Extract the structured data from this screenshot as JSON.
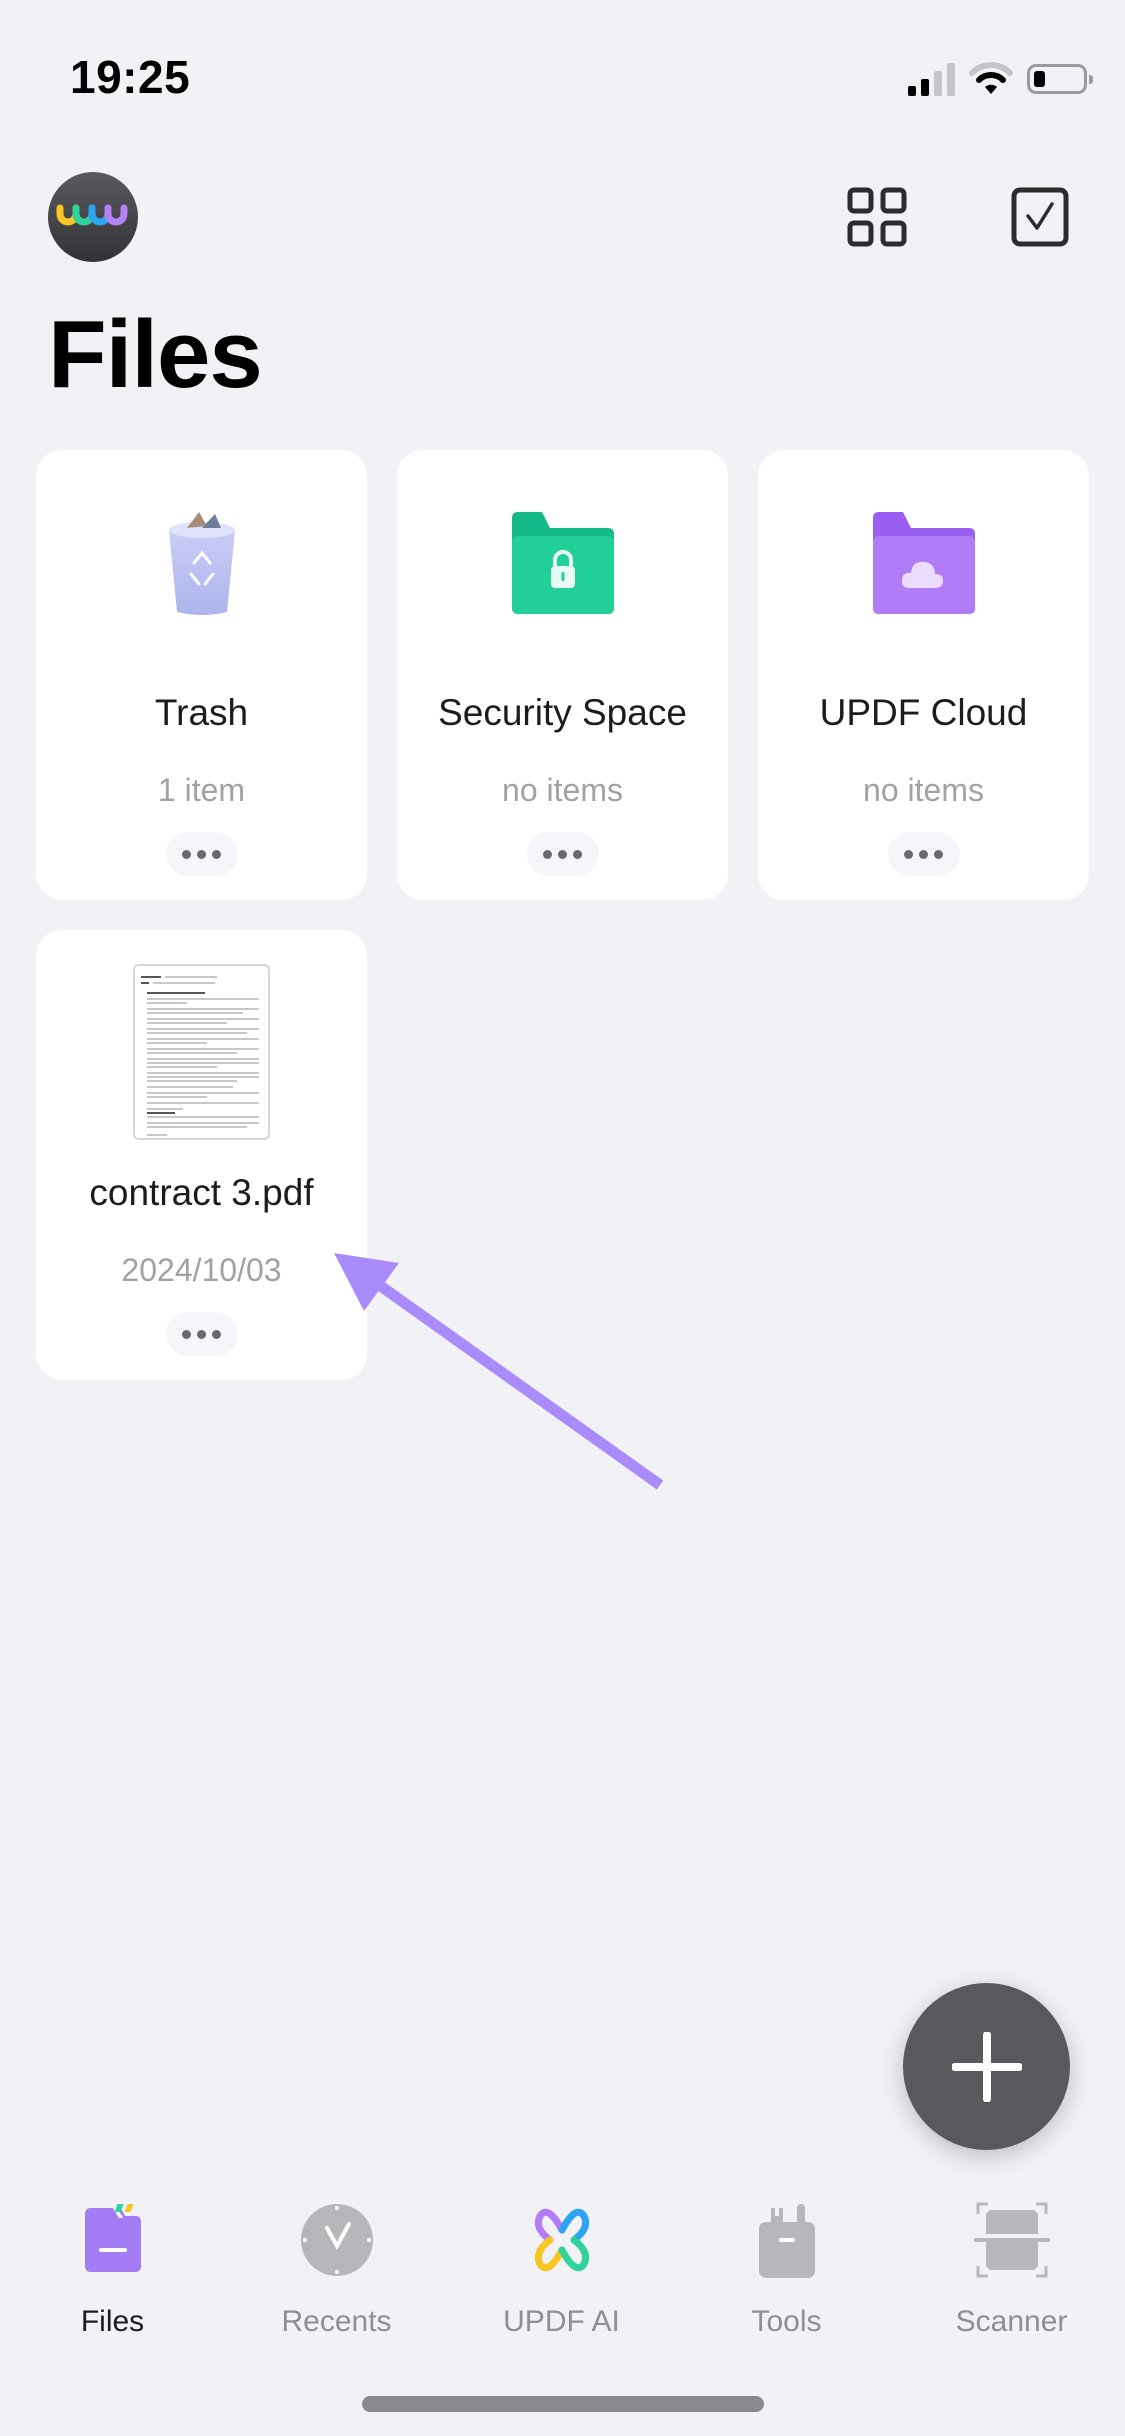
{
  "status_bar": {
    "time": "19:25",
    "signal_icon": "cellular-signal-icon",
    "wifi_icon": "wifi-icon",
    "battery_icon": "battery-low-icon"
  },
  "header": {
    "avatar_icon": "updf-logo-avatar",
    "grid_view_icon": "grid-view-icon",
    "select_icon": "checkbox-select-icon",
    "title": "Files"
  },
  "folders": [
    {
      "name": "Trash",
      "subtitle": "1 item",
      "icon": "trash-bin-icon"
    },
    {
      "name": "Security Space",
      "subtitle": "no items",
      "icon": "locked-folder-icon",
      "color": "#16c08f"
    },
    {
      "name": "UPDF Cloud",
      "subtitle": "no items",
      "icon": "cloud-folder-icon",
      "color": "#a66cf5"
    }
  ],
  "files": [
    {
      "name": "contract 3.pdf",
      "date": "2024/10/03",
      "icon": "pdf-thumbnail"
    }
  ],
  "fab": {
    "icon": "plus-icon"
  },
  "annotation": {
    "arrow_color": "#a98bfb"
  },
  "tab_bar": {
    "active": "Files",
    "active_color": "#a37cf6",
    "items": [
      {
        "label": "Files",
        "icon": "files-folder-icon"
      },
      {
        "label": "Recents",
        "icon": "clock-icon"
      },
      {
        "label": "UPDF AI",
        "icon": "updf-ai-icon"
      },
      {
        "label": "Tools",
        "icon": "toolbox-icon"
      },
      {
        "label": "Scanner",
        "icon": "scanner-icon"
      }
    ]
  }
}
